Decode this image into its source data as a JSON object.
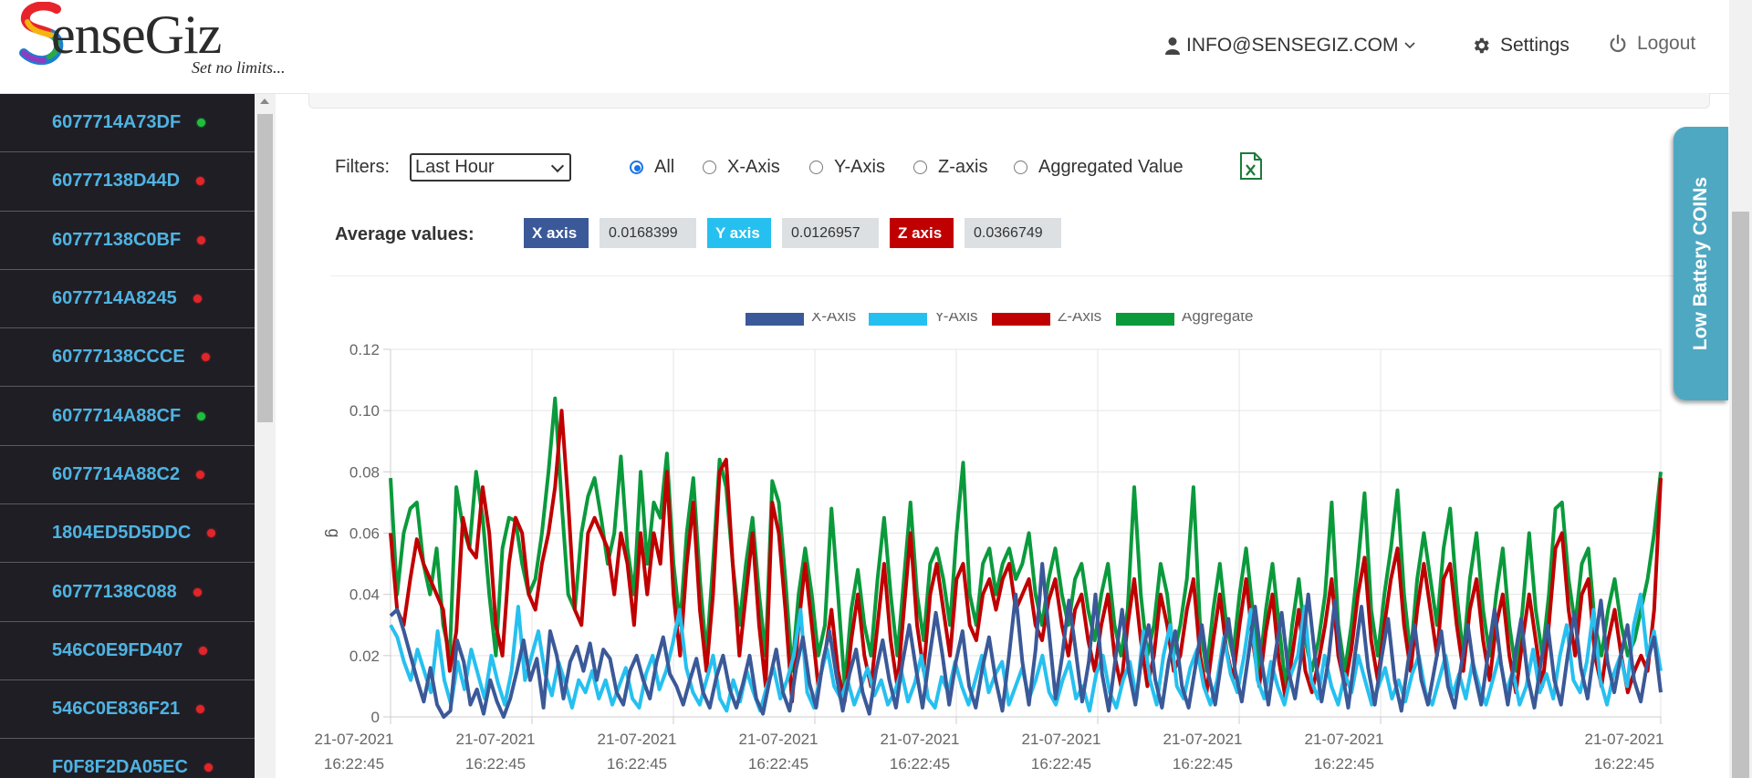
{
  "header": {
    "logo_word": "enseGiz",
    "logo_tagline": "Set no limits...",
    "user_email": "INFO@SENSEGIZ.COM",
    "settings_label": "Settings",
    "logout_label": "Logout"
  },
  "sidebar": {
    "items": [
      {
        "label": "6077714A73DF",
        "status": "green"
      },
      {
        "label": "60777138D44D",
        "status": "red"
      },
      {
        "label": "60777138C0BF",
        "status": "red"
      },
      {
        "label": "6077714A8245",
        "status": "red"
      },
      {
        "label": "60777138CCCE",
        "status": "red"
      },
      {
        "label": "6077714A88CF",
        "status": "green"
      },
      {
        "label": "6077714A88C2",
        "status": "red"
      },
      {
        "label": "1804ED5D5DDC",
        "status": "red"
      },
      {
        "label": "60777138C088",
        "status": "red"
      },
      {
        "label": "546C0E9FD407",
        "status": "red"
      },
      {
        "label": "546C0E836F21",
        "status": "red"
      },
      {
        "label": "F0F8F2DA05EC",
        "status": "red"
      }
    ]
  },
  "filters": {
    "label": "Filters:",
    "selected": "Last Hour",
    "radios": [
      {
        "label": "All",
        "checked": true
      },
      {
        "label": "X-Axis",
        "checked": false
      },
      {
        "label": "Y-Axis",
        "checked": false
      },
      {
        "label": "Z-axis",
        "checked": false
      },
      {
        "label": "Aggregated Value",
        "checked": false
      }
    ],
    "export_icon": "excel-file-icon"
  },
  "averages": {
    "label": "Average values:",
    "x_label": "X axis",
    "x_value": "0.0168399",
    "y_label": "Y axis",
    "y_value": "0.0126957",
    "z_label": "Z axis",
    "z_value": "0.0366749"
  },
  "side_tab": {
    "label": "Low Battery COINs"
  },
  "colors": {
    "x": "#3b5998",
    "y": "#26c0f0",
    "z": "#c00000",
    "aggregate": "#0a9a3c",
    "tab": "#4fa8c2"
  },
  "chart_data": {
    "type": "line",
    "ylabel": "g",
    "ylim": [
      0,
      0.12
    ],
    "yticks": [
      "0",
      "0.02",
      "0.04",
      "0.06",
      "0.08",
      "0.10",
      "0.12"
    ],
    "xticks": [
      {
        "date": "21-07-2021",
        "time": "16:22:45"
      },
      {
        "date": "21-07-2021",
        "time": "16:22:45"
      },
      {
        "date": "21-07-2021",
        "time": "16:22:45"
      },
      {
        "date": "21-07-2021",
        "time": "16:22:45"
      },
      {
        "date": "21-07-2021",
        "time": "16:22:45"
      },
      {
        "date": "21-07-2021",
        "time": "16:22:45"
      },
      {
        "date": "21-07-2021",
        "time": "16:22:45"
      },
      {
        "date": "21-07-2021",
        "time": "16:22:45"
      },
      {
        "date": "21-07-2021",
        "time": "16:22:45"
      }
    ],
    "legend_position": "top-center",
    "series": [
      {
        "name": "X-Axis",
        "values": [
          0.033,
          0.035,
          0.028,
          0.02,
          0.012,
          0.005,
          0.016,
          0.004,
          0,
          0.002,
          0.025,
          0.018,
          0.004,
          0.009,
          0.001,
          0.012,
          0.005,
          0,
          0.006,
          0.015,
          0.025,
          0.012,
          0.019,
          0.003,
          0.028,
          0.02,
          0.006,
          0.018,
          0.023,
          0.015,
          0.024,
          0.012,
          0.022,
          0.019,
          0.008,
          0.004,
          0.015,
          0.02,
          0.012,
          0.006,
          0.018,
          0.026,
          0.014,
          0.01,
          0.004,
          0.012,
          0.019,
          0.008,
          0.003,
          0.013,
          0.02,
          0.009,
          0.003,
          0.011,
          0.02,
          0.006,
          0.001,
          0.012,
          0.022,
          0.008,
          0.002,
          0.016,
          0.026,
          0.011,
          0.003,
          0.018,
          0.028,
          0.014,
          0.002,
          0.014,
          0.022,
          0.008,
          0.001,
          0.015,
          0.025,
          0.012,
          0.003,
          0.018,
          0.03,
          0.016,
          0.003,
          0.019,
          0.034,
          0.02,
          0.004,
          0.018,
          0.028,
          0.01,
          0.003,
          0.016,
          0.026,
          0.012,
          0.002,
          0.02,
          0.04,
          0.018,
          0.004,
          0.022,
          0.05,
          0.028,
          0.006,
          0.02,
          0.038,
          0.022,
          0.005,
          0.018,
          0.04,
          0.014,
          0.002,
          0.019,
          0.035,
          0.015,
          0.004,
          0.02,
          0.03,
          0.012,
          0.003,
          0.018,
          0.028,
          0.01,
          0.003,
          0.016,
          0.03,
          0.014,
          0.004,
          0.019,
          0.032,
          0.015,
          0.005,
          0.02,
          0.036,
          0.018,
          0.004,
          0.02,
          0.034,
          0.015,
          0.006,
          0.021,
          0.04,
          0.02,
          0.005,
          0.018,
          0.038,
          0.016,
          0.003,
          0.02,
          0.036,
          0.016,
          0.004,
          0.019,
          0.032,
          0.012,
          0.002,
          0.018,
          0.03,
          0.012,
          0.004,
          0.016,
          0.028,
          0.01,
          0.003,
          0.017,
          0.03,
          0.014,
          0.004,
          0.02,
          0.035,
          0.017,
          0.004,
          0.019,
          0.032,
          0.013,
          0.003,
          0.018,
          0.03,
          0.012,
          0.004,
          0.02,
          0.034,
          0.016,
          0.006,
          0.022,
          0.038,
          0.018,
          0.008,
          0.02,
          0.03,
          0.012,
          0.005,
          0.018,
          0.026,
          0.008
        ]
      },
      {
        "name": "Y-Axis",
        "values": [
          0.03,
          0.026,
          0.018,
          0.012,
          0.022,
          0.015,
          0.008,
          0.028,
          0.012,
          0.004,
          0.018,
          0.009,
          0.022,
          0.014,
          0.006,
          0.02,
          0.011,
          0.004,
          0.015,
          0.036,
          0.012,
          0.02,
          0.028,
          0.014,
          0.007,
          0.018,
          0.011,
          0.003,
          0.012,
          0.008,
          0.015,
          0.006,
          0.012,
          0.004,
          0.01,
          0.016,
          0.006,
          0.003,
          0.014,
          0.02,
          0.009,
          0.015,
          0.024,
          0.035,
          0.016,
          0.008,
          0.004,
          0.012,
          0.02,
          0.006,
          0.002,
          0.012,
          0.005,
          0.015,
          0.008,
          0.002,
          0.01,
          0.016,
          0.006,
          0.012,
          0.02,
          0.035,
          0.008,
          0.003,
          0.014,
          0.022,
          0.01,
          0.006,
          0.012,
          0.004,
          0.01,
          0.016,
          0.007,
          0.012,
          0.004,
          0.008,
          0.015,
          0.005,
          0.011,
          0.02,
          0.006,
          0.003,
          0.013,
          0.008,
          0.018,
          0.01,
          0.004,
          0.012,
          0.02,
          0.008,
          0.014,
          0.018,
          0.004,
          0.01,
          0.016,
          0.006,
          0.012,
          0.02,
          0.008,
          0.004,
          0.012,
          0.018,
          0.006,
          0.01,
          0.002,
          0.014,
          0.02,
          0.008,
          0.003,
          0.012,
          0.018,
          0.006,
          0.028,
          0.012,
          0.004,
          0.02,
          0.03,
          0.01,
          0.006,
          0.016,
          0.022,
          0.01,
          0.004,
          0.012,
          0.026,
          0.014,
          0.008,
          0.02,
          0.035,
          0.012,
          0.006,
          0.018,
          0.01,
          0.004,
          0.014,
          0.02,
          0.036,
          0.012,
          0.006,
          0.02,
          0.01,
          0.004,
          0.014,
          0.008,
          0.02,
          0.012,
          0.004,
          0.01,
          0.016,
          0.006,
          0.012,
          0.005,
          0.014,
          0.02,
          0.008,
          0.004,
          0.012,
          0.02,
          0.007,
          0.014,
          0.006,
          0.018,
          0.01,
          0.004,
          0.012,
          0.02,
          0.008,
          0.015,
          0.004,
          0.01,
          0.022,
          0.008,
          0.014,
          0.006,
          0.02,
          0.03,
          0.012,
          0.008,
          0.018,
          0.035,
          0.012,
          0.004,
          0.014,
          0.02,
          0.01,
          0.03,
          0.04,
          0.02,
          0.028,
          0.015
        ]
      },
      {
        "name": "Z-Axis",
        "values": [
          0.06,
          0.035,
          0.03,
          0.045,
          0.058,
          0.05,
          0.045,
          0.04,
          0.035,
          0.015,
          0.028,
          0.065,
          0.055,
          0.052,
          0.075,
          0.06,
          0.03,
          0.02,
          0.05,
          0.065,
          0.06,
          0.04,
          0.035,
          0.05,
          0.06,
          0.075,
          0.1,
          0.07,
          0.035,
          0.03,
          0.06,
          0.065,
          0.06,
          0.055,
          0.04,
          0.06,
          0.05,
          0.03,
          0.06,
          0.04,
          0.06,
          0.05,
          0.08,
          0.04,
          0.02,
          0.05,
          0.07,
          0.035,
          0.015,
          0.04,
          0.08,
          0.084,
          0.05,
          0.02,
          0.04,
          0.06,
          0.03,
          0.01,
          0.07,
          0.06,
          0.035,
          0.005,
          0.03,
          0.05,
          0.03,
          0.01,
          0.02,
          0.035,
          0.015,
          0.005,
          0.025,
          0.04,
          0.02,
          0.01,
          0.03,
          0.05,
          0.025,
          0.01,
          0.035,
          0.06,
          0.03,
          0.015,
          0.04,
          0.05,
          0.035,
          0.02,
          0.045,
          0.05,
          0.03,
          0.025,
          0.04,
          0.045,
          0.035,
          0.045,
          0.05,
          0.035,
          0.04,
          0.045,
          0.03,
          0.025,
          0.038,
          0.045,
          0.03,
          0.02,
          0.035,
          0.04,
          0.025,
          0.015,
          0.03,
          0.04,
          0.02,
          0.01,
          0.03,
          0.045,
          0.025,
          0.01,
          0.02,
          0.04,
          0.03,
          0.015,
          0.02,
          0.035,
          0.045,
          0.02,
          0.008,
          0.025,
          0.04,
          0.022,
          0.012,
          0.03,
          0.045,
          0.025,
          0.01,
          0.028,
          0.04,
          0.018,
          0.006,
          0.02,
          0.035,
          0.015,
          0.008,
          0.018,
          0.03,
          0.045,
          0.02,
          0.01,
          0.022,
          0.04,
          0.052,
          0.025,
          0.012,
          0.03,
          0.045,
          0.055,
          0.03,
          0.015,
          0.035,
          0.05,
          0.035,
          0.02,
          0.045,
          0.05,
          0.03,
          0.015,
          0.035,
          0.045,
          0.025,
          0.012,
          0.03,
          0.04,
          0.02,
          0.008,
          0.025,
          0.04,
          0.025,
          0.01,
          0.03,
          0.055,
          0.06,
          0.035,
          0.02,
          0.04,
          0.045,
          0.02,
          0.01,
          0.025,
          0.035,
          0.02,
          0.008,
          0.015,
          0.02,
          0.015,
          0.035,
          0.078
        ]
      },
      {
        "name": "Aggregate",
        "values": [
          0.078,
          0.04,
          0.06,
          0.068,
          0.07,
          0.05,
          0.04,
          0.055,
          0.03,
          0.02,
          0.075,
          0.062,
          0.055,
          0.08,
          0.065,
          0.04,
          0.02,
          0.055,
          0.065,
          0.064,
          0.05,
          0.04,
          0.045,
          0.06,
          0.08,
          0.104,
          0.07,
          0.04,
          0.035,
          0.06,
          0.072,
          0.078,
          0.065,
          0.05,
          0.06,
          0.085,
          0.055,
          0.04,
          0.08,
          0.05,
          0.07,
          0.065,
          0.086,
          0.05,
          0.03,
          0.06,
          0.078,
          0.045,
          0.02,
          0.05,
          0.084,
          0.075,
          0.05,
          0.03,
          0.05,
          0.065,
          0.04,
          0.02,
          0.077,
          0.07,
          0.045,
          0.015,
          0.04,
          0.055,
          0.04,
          0.02,
          0.03,
          0.068,
          0.04,
          0.01,
          0.035,
          0.048,
          0.03,
          0.02,
          0.045,
          0.065,
          0.04,
          0.02,
          0.045,
          0.07,
          0.04,
          0.025,
          0.05,
          0.055,
          0.045,
          0.03,
          0.06,
          0.083,
          0.04,
          0.03,
          0.05,
          0.055,
          0.04,
          0.05,
          0.055,
          0.045,
          0.05,
          0.06,
          0.04,
          0.03,
          0.045,
          0.055,
          0.04,
          0.03,
          0.045,
          0.05,
          0.035,
          0.025,
          0.04,
          0.05,
          0.03,
          0.02,
          0.035,
          0.075,
          0.04,
          0.02,
          0.03,
          0.05,
          0.04,
          0.02,
          0.03,
          0.045,
          0.075,
          0.03,
          0.015,
          0.035,
          0.05,
          0.03,
          0.02,
          0.04,
          0.055,
          0.035,
          0.015,
          0.035,
          0.05,
          0.03,
          0.01,
          0.03,
          0.045,
          0.025,
          0.015,
          0.025,
          0.04,
          0.07,
          0.03,
          0.015,
          0.03,
          0.05,
          0.073,
          0.035,
          0.02,
          0.04,
          0.055,
          0.074,
          0.04,
          0.02,
          0.045,
          0.06,
          0.045,
          0.03,
          0.055,
          0.068,
          0.04,
          0.02,
          0.045,
          0.06,
          0.035,
          0.02,
          0.04,
          0.055,
          0.03,
          0.015,
          0.035,
          0.06,
          0.035,
          0.02,
          0.04,
          0.068,
          0.07,
          0.045,
          0.03,
          0.05,
          0.055,
          0.03,
          0.02,
          0.035,
          0.045,
          0.03,
          0.02,
          0.025,
          0.035,
          0.045,
          0.06,
          0.08
        ]
      }
    ]
  }
}
